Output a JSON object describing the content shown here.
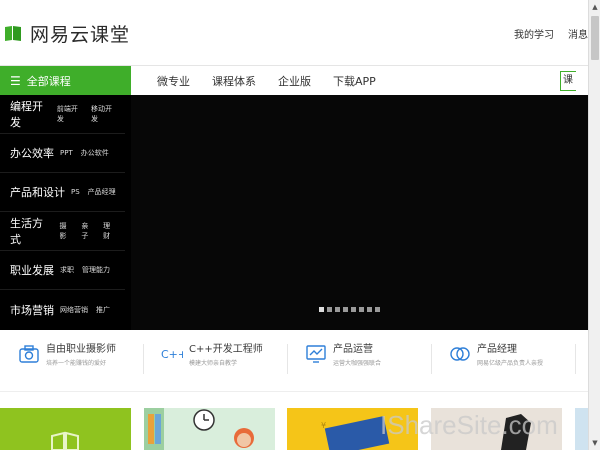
{
  "header": {
    "logo_text": "网易云课堂",
    "links": [
      "我的学习",
      "消息"
    ]
  },
  "nav": {
    "all_courses_label": "全部课程",
    "items": [
      "微专业",
      "课程体系",
      "企业版",
      "下载APP"
    ],
    "search_stub": "课"
  },
  "sidebar": {
    "categories": [
      {
        "title": "编程开发",
        "subs": [
          "前端开发",
          "移动开发"
        ]
      },
      {
        "title": "办公效率",
        "subs": [
          "PPT",
          "办公软件"
        ]
      },
      {
        "title": "产品和设计",
        "subs": [
          "PS",
          "产品经理"
        ]
      },
      {
        "title": "生活方式",
        "subs": [
          "摄影",
          "亲子",
          "理财"
        ]
      },
      {
        "title": "职业发展",
        "subs": [
          "求职",
          "管理能力"
        ]
      },
      {
        "title": "市场营销",
        "subs": [
          "网络营销",
          "推广"
        ]
      }
    ]
  },
  "banner": {
    "slide_count": 8,
    "active_slide": 1
  },
  "features": [
    {
      "title": "自由职业摄影师",
      "subtitle": "培养一个能赚钱的爱好",
      "icon": "camera-icon"
    },
    {
      "title": "C++开发工程师",
      "subtitle": "模建大师亲自教学",
      "icon": "cpp-icon"
    },
    {
      "title": "产品运营",
      "subtitle": "运营大咖强强联合",
      "icon": "chart-screen-icon"
    },
    {
      "title": "产品经理",
      "subtitle": "网易亿级产品负责人亲授",
      "icon": "overlap-circles-icon"
    }
  ],
  "watermark": "IShareSite.com",
  "colors": {
    "brand_green": "#3fae2a",
    "banner_bg": "#070707"
  }
}
